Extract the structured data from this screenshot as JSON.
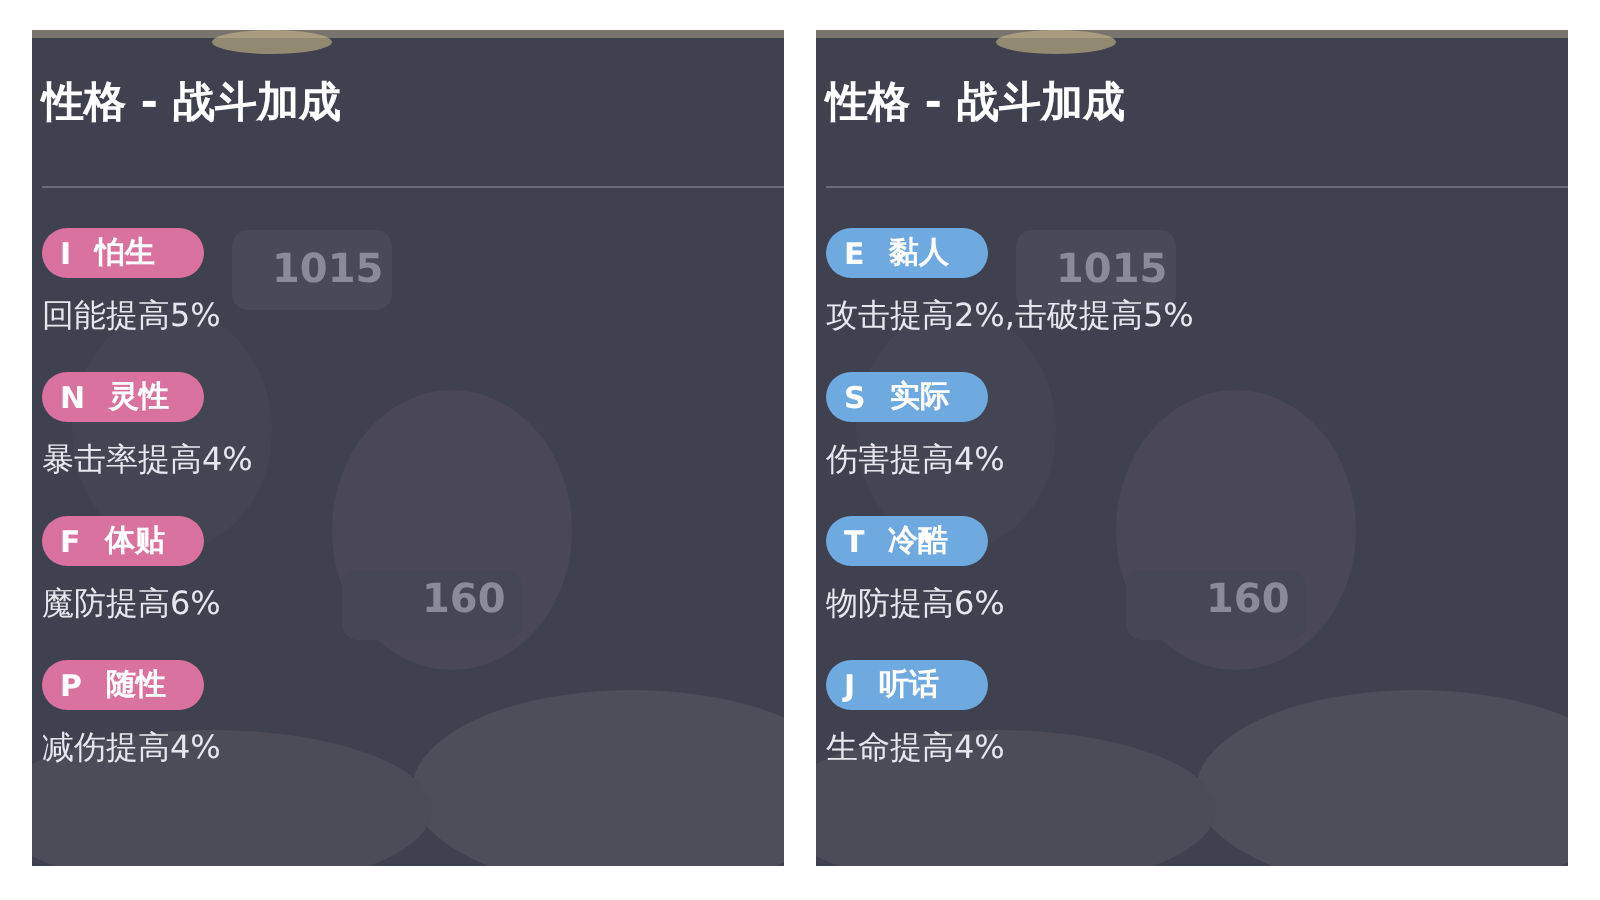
{
  "panels": [
    {
      "title": "性格 - 战斗加成",
      "faded_texts": [
        "1015",
        "160"
      ],
      "traits": [
        {
          "letter": "I",
          "name": "怕生",
          "color": "#d9729e",
          "effect": "回能提高5%"
        },
        {
          "letter": "N",
          "name": "灵性",
          "color": "#d9729e",
          "effect": "暴击率提高4%"
        },
        {
          "letter": "F",
          "name": "体贴",
          "color": "#d9729e",
          "effect": "魔防提高6%"
        },
        {
          "letter": "P",
          "name": "随性",
          "color": "#d9729e",
          "effect": "减伤提高4%"
        }
      ]
    },
    {
      "title": "性格 - 战斗加成",
      "faded_texts": [
        "1015",
        "160"
      ],
      "traits": [
        {
          "letter": "E",
          "name": "黏人",
          "color": "#6ea9e0",
          "effect": "攻击提高2%,击破提高5%"
        },
        {
          "letter": "S",
          "name": "实际",
          "color": "#6ea9e0",
          "effect": "伤害提高4%"
        },
        {
          "letter": "T",
          "name": "冷酷",
          "color": "#6ea9e0",
          "effect": "物防提高6%"
        },
        {
          "letter": "J",
          "name": "听话",
          "color": "#6ea9e0",
          "effect": "生命提高4%"
        }
      ]
    }
  ]
}
